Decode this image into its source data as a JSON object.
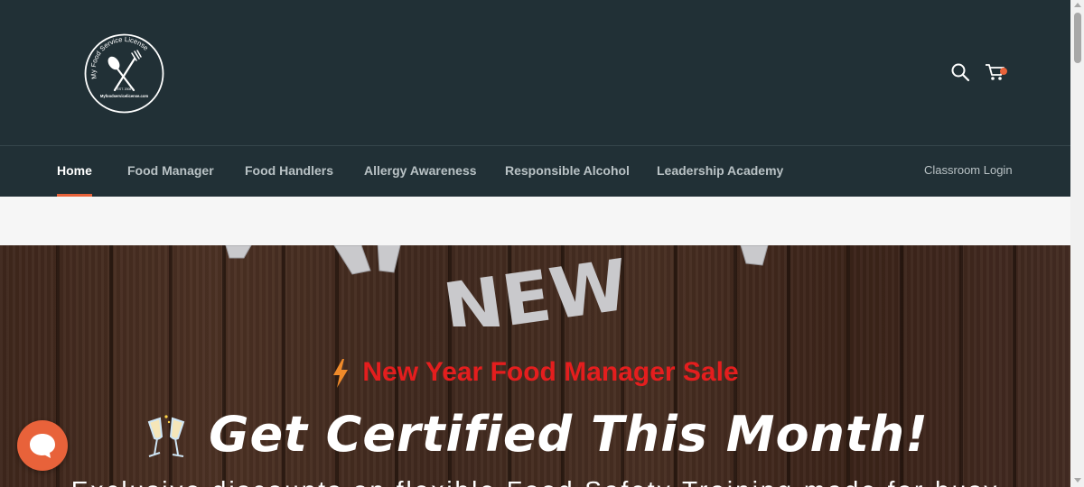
{
  "header": {
    "logo": {
      "name": "My Food Service License",
      "est": "EST. 2008",
      "url": "Myfoodservicelicense.com"
    },
    "search_icon": "search-icon",
    "cart_icon": "cart-icon"
  },
  "nav": {
    "items": [
      {
        "label": "Home",
        "active": true
      },
      {
        "label": "Food Manager"
      },
      {
        "label": "Food Handlers"
      },
      {
        "label": "Allergy Awareness"
      },
      {
        "label": "Responsible Alcohol"
      },
      {
        "label": "Leadership Academy"
      }
    ],
    "login_label": "Classroom Login"
  },
  "hero": {
    "decor_text": "NEW",
    "subtitle": "New Year Food Manager Sale",
    "title": "Get Certified This Month!",
    "description": "Exclusive discounts on flexible Food Safety Training made for busy"
  },
  "chat": {
    "icon": "chat-icon"
  },
  "colors": {
    "header_bg": "#213036",
    "accent": "#e8623a",
    "sale_red": "#e41e1e"
  }
}
